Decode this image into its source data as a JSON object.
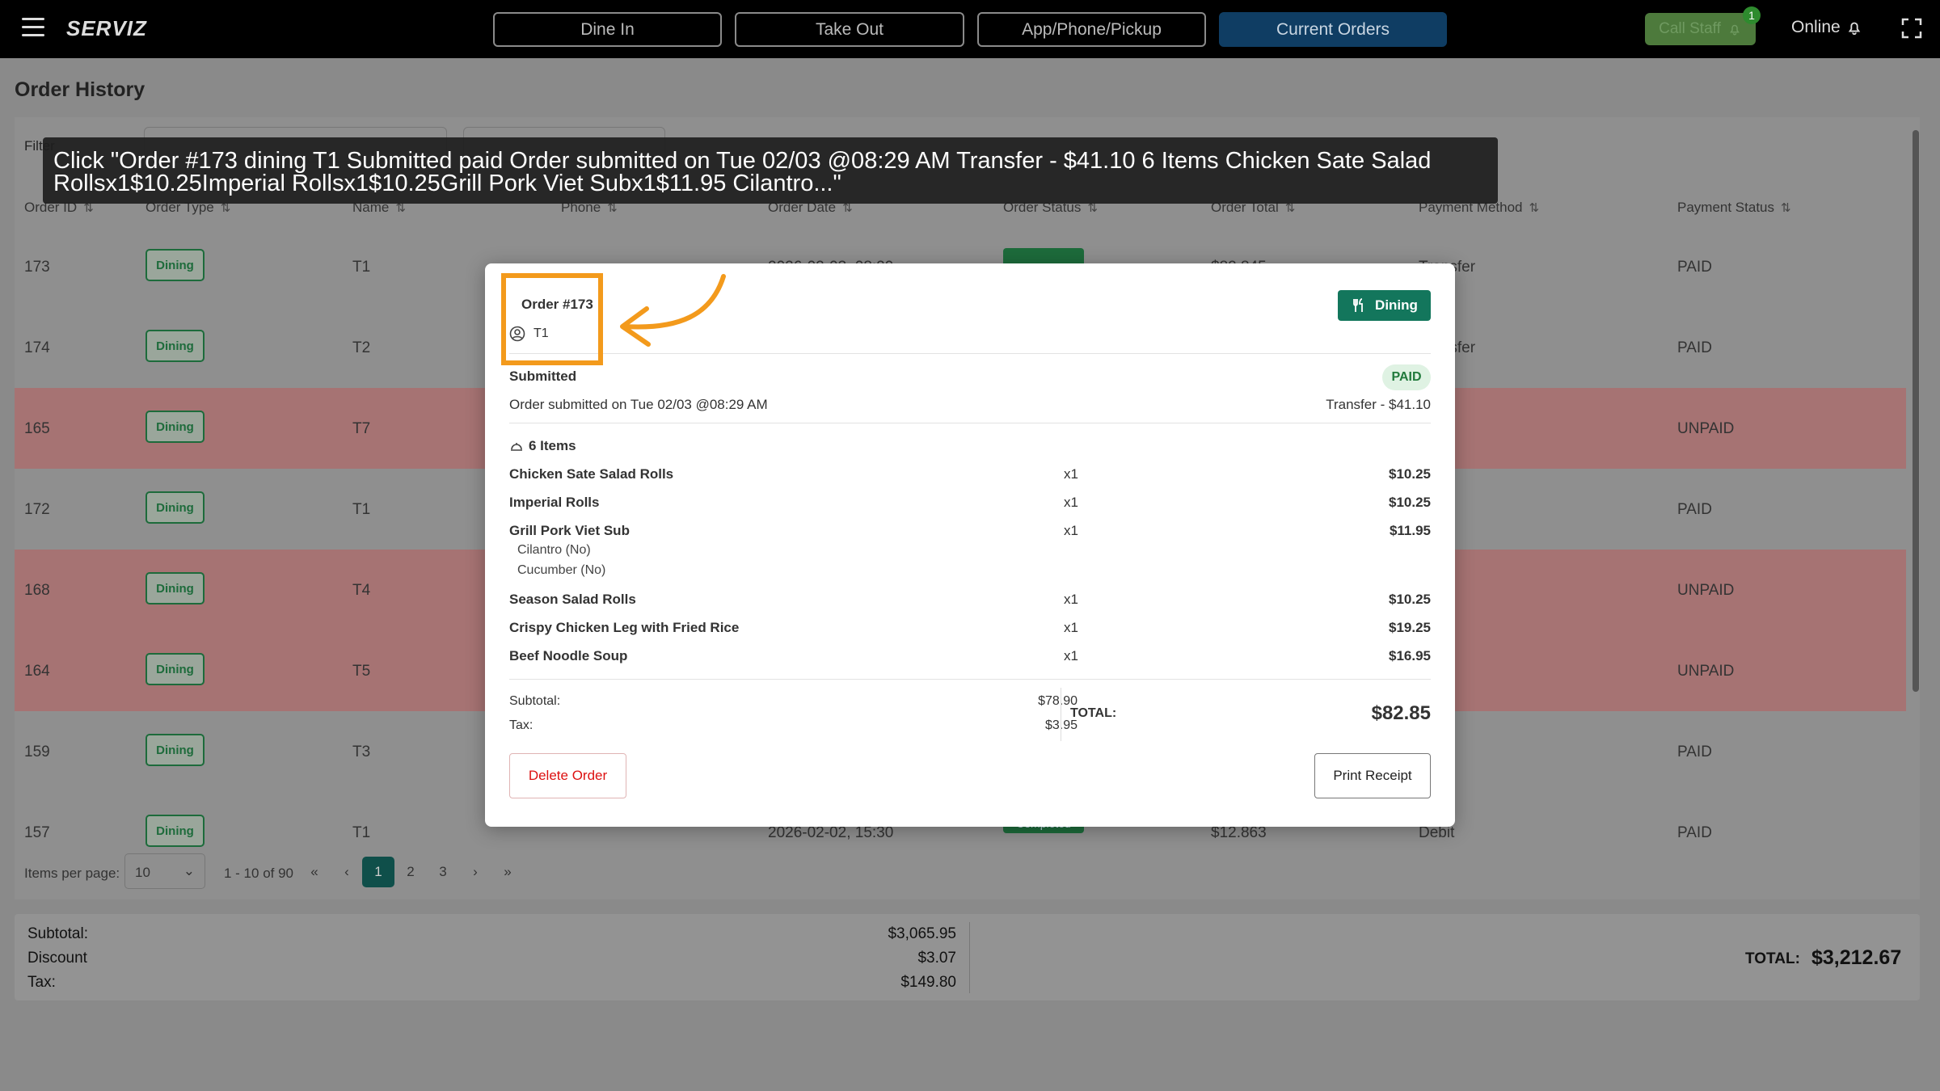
{
  "topbar": {
    "brand": "SERVIZ",
    "nav": [
      {
        "label": "Dine In"
      },
      {
        "label": "Take Out"
      },
      {
        "label": "App/Phone/Pickup"
      },
      {
        "label": "Current Orders"
      }
    ],
    "call_staff": "Call Staff",
    "call_staff_badge": "1",
    "online": "Online"
  },
  "page_title": "Order History",
  "filter": {
    "label": "Filter"
  },
  "table": {
    "headers": [
      "Order ID",
      "Order Type",
      "Name",
      "Phone",
      "Order Date",
      "Order Status",
      "Order Total",
      "Payment Method",
      "Payment Status"
    ],
    "rows": [
      {
        "id": "173",
        "type": "Dining",
        "name": "T1",
        "date": "2026-02-03, 08:29",
        "total": "$82.845",
        "method": "Transfer",
        "payment": "PAID",
        "unpaid": false
      },
      {
        "id": "174",
        "type": "Dining",
        "name": "T2",
        "date": "",
        "total": "",
        "method": "Transfer",
        "payment": "PAID",
        "unpaid": false
      },
      {
        "id": "165",
        "type": "Dining",
        "name": "T7",
        "date": "",
        "total": "",
        "method": "",
        "payment": "UNPAID",
        "unpaid": true
      },
      {
        "id": "172",
        "type": "Dining",
        "name": "T1",
        "date": "",
        "total": "",
        "method": "",
        "payment": "PAID",
        "unpaid": false
      },
      {
        "id": "168",
        "type": "Dining",
        "name": "T4",
        "date": "",
        "total": "",
        "method": "",
        "payment": "UNPAID",
        "unpaid": true
      },
      {
        "id": "164",
        "type": "Dining",
        "name": "T5",
        "date": "",
        "total": "",
        "method": "",
        "payment": "UNPAID",
        "unpaid": true
      },
      {
        "id": "159",
        "type": "Dining",
        "name": "T3",
        "date": "",
        "total": "",
        "method": "",
        "payment": "PAID",
        "unpaid": false
      },
      {
        "id": "157",
        "type": "Dining",
        "name": "T1",
        "date": "2026-02-02, 15:30",
        "status": "Completed",
        "total": "$12.863",
        "method": "Debit",
        "payment": "PAID",
        "unpaid": false
      }
    ]
  },
  "pager": {
    "label": "Items per page:",
    "per_page": "10",
    "range": "1 - 10 of 90",
    "pages": [
      "1",
      "2",
      "3"
    ]
  },
  "totals": {
    "subtotal_label": "Subtotal:",
    "subtotal": "$3,065.95",
    "discount_label": "Discount",
    "discount": "$3.07",
    "tax_label": "Tax:",
    "tax": "$149.80",
    "total_label": "TOTAL:",
    "total": "$3,212.67"
  },
  "modal": {
    "order": "Order #173",
    "table": "T1",
    "type": "Dining",
    "status": "Submitted",
    "payment_status": "PAID",
    "submitted": "Order submitted on Tue 02/03 @08:29 AM",
    "payment": "Transfer - $41.10",
    "items_count": "6 Items",
    "items": [
      {
        "name": "Chicken Sate Salad Rolls",
        "qty": "x1",
        "price": "$10.25"
      },
      {
        "name": "Imperial Rolls",
        "qty": "x1",
        "price": "$10.25"
      },
      {
        "name": "Grill Pork Viet Sub",
        "qty": "x1",
        "price": "$11.95"
      },
      {
        "name": "Season Salad Rolls",
        "qty": "x1",
        "price": "$10.25"
      },
      {
        "name": "Crispy Chicken Leg with Fried Rice",
        "qty": "x1",
        "price": "$19.25"
      },
      {
        "name": "Beef Noodle Soup",
        "qty": "x1",
        "price": "$16.95"
      }
    ],
    "modifiers": [
      "Cilantro (No)",
      "Cucumber (No)"
    ],
    "subtotal_label": "Subtotal:",
    "subtotal": "$78.90",
    "tax_label": "Tax:",
    "tax": "$3.95",
    "total_label": "TOTAL:",
    "total": "$82.85",
    "delete_label": "Delete Order",
    "print_label": "Print Receipt"
  },
  "tooltip": {
    "line1": "Click \"Order #173 dining T1 Submitted  paid  Order submitted on Tue 02/03 @08:29 AM  Transfer - $41.10  6 Items Chicken Sate Salad",
    "line2": "Rollsx1$10.25Imperial Rollsx1$10.25Grill Pork Viet Subx1$11.95 Cilantro...\""
  },
  "colors": {
    "accent": "#f39a1c",
    "brand_green": "#13765c",
    "nav_active": "#0f3d63"
  }
}
